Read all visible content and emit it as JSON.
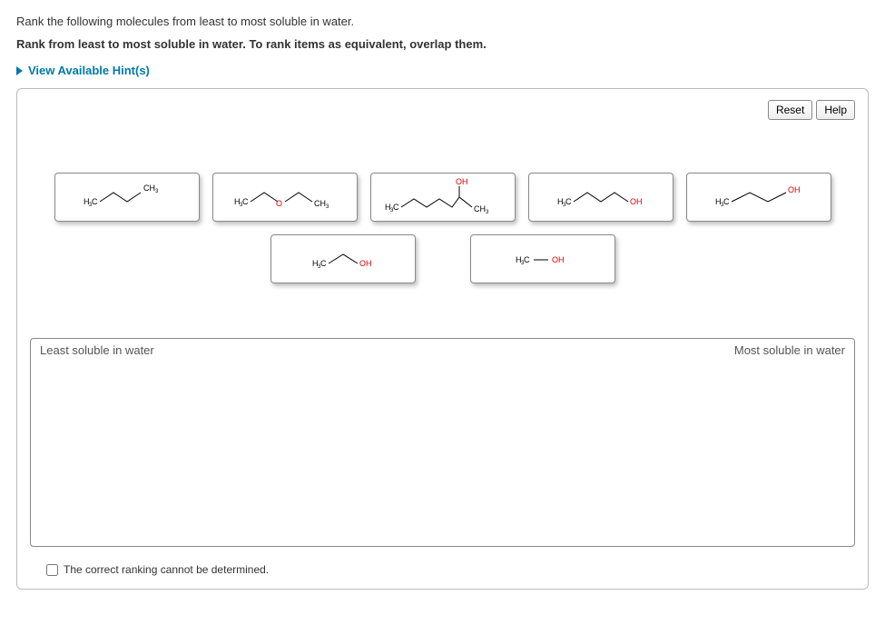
{
  "question": {
    "line1": "Rank the following molecules from least to most soluble in water.",
    "line2": "Rank from least to most soluble in water. To rank items as equivalent, overlap them."
  },
  "hints_label": "View Available Hint(s)",
  "buttons": {
    "reset": "Reset",
    "help": "Help"
  },
  "dropzone": {
    "left_label": "Least soluble in water",
    "right_label": "Most soluble in water"
  },
  "checkbox_label": "The correct ranking cannot be determined.",
  "tiles": {
    "row1": [
      {
        "id": "mol-butane",
        "left": "H₃C",
        "right": "CH₃",
        "right_red": false,
        "zigzag": 3
      },
      {
        "id": "mol-ether",
        "left": "H₃C",
        "right": "CH₃",
        "mid_o": true,
        "zigzag": 4
      },
      {
        "id": "mol-branched",
        "left": "H₃C",
        "right": "CH₃",
        "top_oh": true,
        "zigzag": 5
      },
      {
        "id": "mol-butanol",
        "left": "H₃C",
        "right": "OH",
        "right_red": true,
        "zigzag": 3
      },
      {
        "id": "mol-propenol",
        "left": "H₃C",
        "right": "OH",
        "right_red": true,
        "zigzag": 3
      }
    ],
    "row2": [
      {
        "id": "mol-ethanol",
        "left": "H₃C",
        "right": "OH",
        "right_red": true,
        "zigzag": 1
      },
      {
        "id": "mol-methanol",
        "text": "H₃C — OH",
        "right_red": true
      }
    ]
  }
}
